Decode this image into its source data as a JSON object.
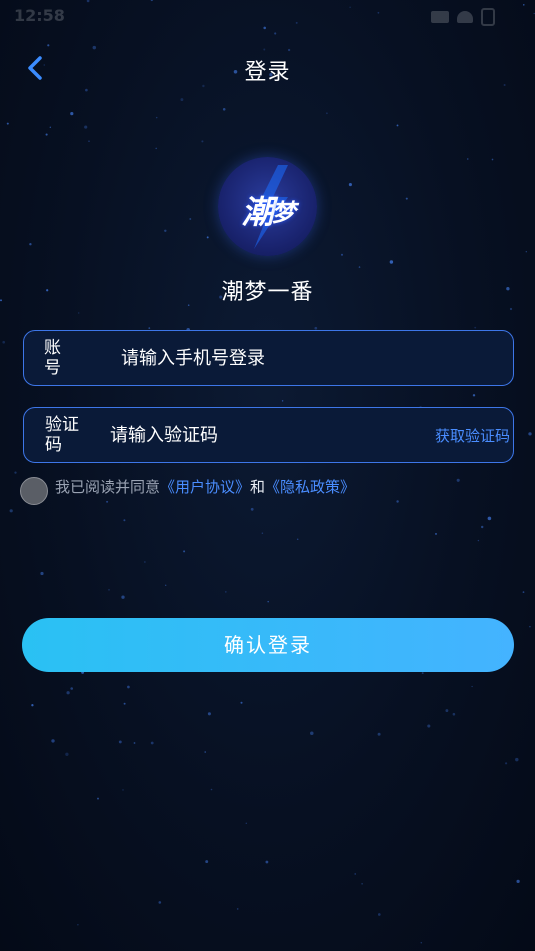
{
  "status_bar": {
    "time": "12:58"
  },
  "header": {
    "title": "登录",
    "back_icon": "chevron-left-icon"
  },
  "brand": {
    "logo_main": "潮",
    "logo_small": "梦",
    "app_name": "潮梦一番"
  },
  "form": {
    "account": {
      "label": "账号",
      "placeholder": "请输入手机号登录",
      "value": ""
    },
    "code": {
      "label": "验证码",
      "placeholder": "请输入验证码",
      "value": "",
      "get_code": "获取验证码"
    }
  },
  "agreement": {
    "checked": false,
    "prefix": "我已阅读并同意",
    "user_agreement": "《用户协议》",
    "and": "和",
    "privacy_policy": "《隐私政策》"
  },
  "submit": {
    "label": "确认登录"
  },
  "colors": {
    "accent": "#4a8dff",
    "field_border": "#3d76e8",
    "button_start": "#2ac1f3",
    "button_end": "#44b3ff",
    "background": "#071022"
  }
}
